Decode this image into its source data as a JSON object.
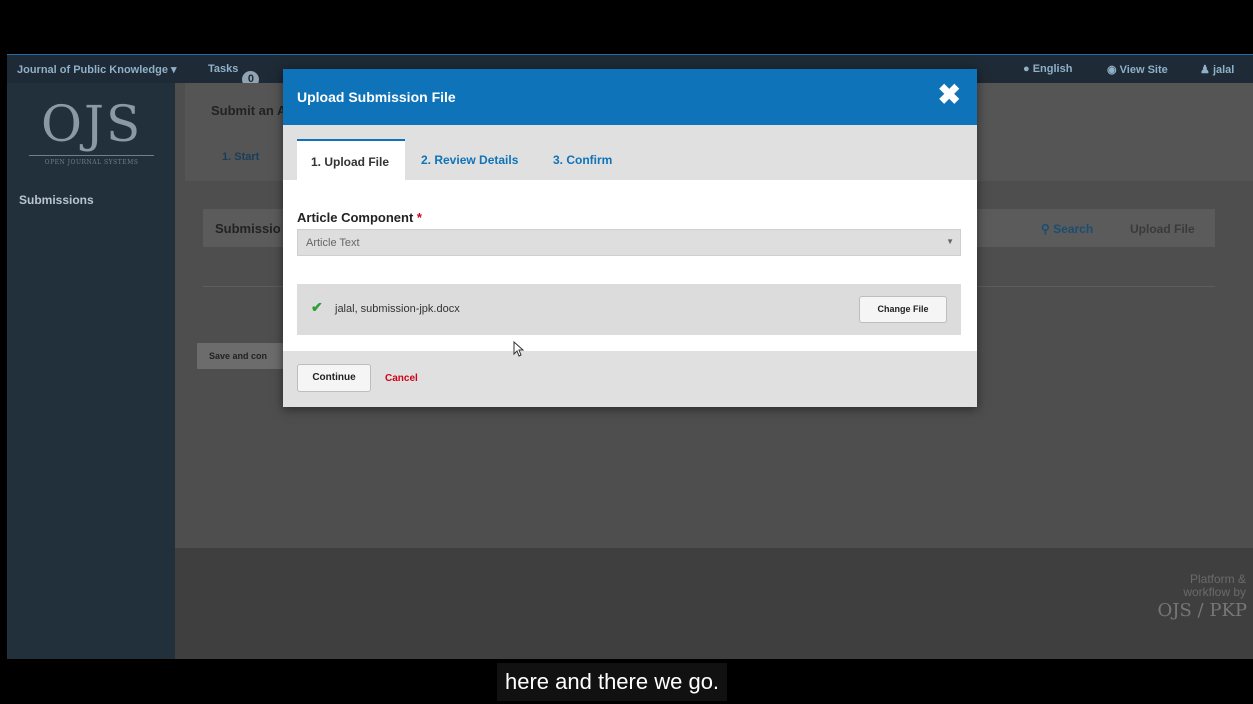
{
  "topbar": {
    "journal": "Journal of Public Knowledge",
    "journal_arrow": "▾",
    "tasks_label": "Tasks",
    "tasks_count": "0",
    "language": "English",
    "view_site": "View Site",
    "user": "jalal"
  },
  "sidebar": {
    "logo": "OJS",
    "logo_sub": "OPEN JOURNAL SYSTEMS",
    "submissions": "Submissions"
  },
  "main": {
    "title": "Submit an A",
    "step": "1. Start",
    "panel_title": "Submissio",
    "search": "Search",
    "upload_file": "Upload File",
    "save_button": "Save and con"
  },
  "footer": {
    "text_line1": "Platform &",
    "text_line2": "workflow by",
    "logo": "OJS / PKP"
  },
  "dialog": {
    "title": "Upload Submission File",
    "tabs": [
      "1. Upload File",
      "2. Review Details",
      "3. Confirm"
    ],
    "field_label": "Article Component",
    "required_marker": "*",
    "select_value": "Article Text",
    "file_name": "jalal, submission-jpk.docx",
    "change_file": "Change File",
    "continue": "Continue",
    "cancel": "Cancel"
  },
  "caption": "here and there we go.",
  "colors": {
    "header_blue": "#0f73b9",
    "required_red": "#d0021b",
    "check_green": "#2aa035"
  },
  "icons": [
    "close-icon",
    "check-icon",
    "search-icon",
    "eye-icon",
    "user-icon",
    "globe-icon",
    "cursor-icon",
    "chevron-down-icon"
  ]
}
